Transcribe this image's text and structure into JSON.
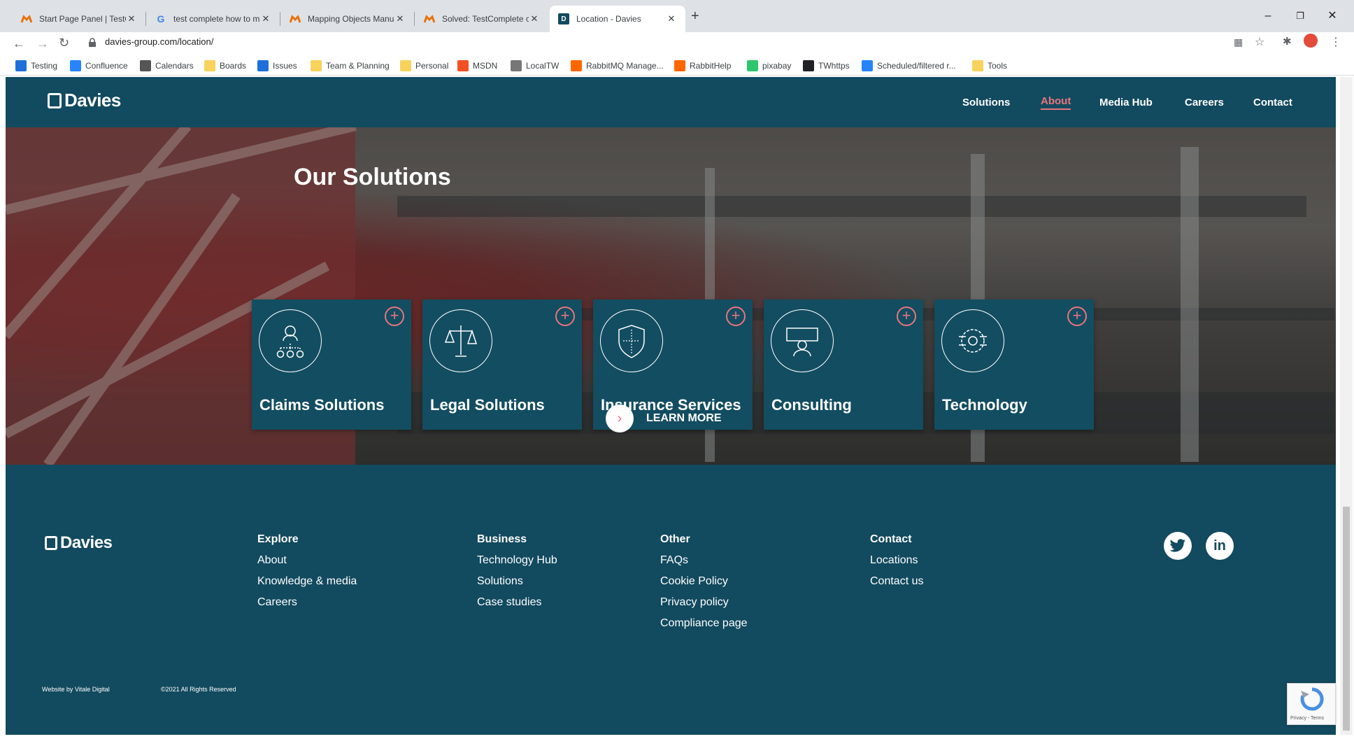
{
  "browser": {
    "tabs": [
      {
        "title": "Start Page Panel | TestComplete",
        "icon": "smartbear-icon",
        "color": "#e8710a"
      },
      {
        "title": "test complete how to map an ob",
        "icon": "google-icon",
        "color": "#4285f4"
      },
      {
        "title": "Mapping Objects Manually | Test",
        "icon": "smartbear-icon",
        "color": "#e8710a"
      },
      {
        "title": "Solved: TestComplete cannot finc",
        "icon": "smartbear-icon",
        "color": "#e8710a"
      },
      {
        "title": "Location - Davies",
        "icon": "davies-icon",
        "color": "#124a5f"
      }
    ],
    "new_tab": "+",
    "window_controls": {
      "minimize": "–",
      "restore": "❐",
      "close": "✕"
    },
    "url": "davies-group.com/location/",
    "bookmarks": [
      {
        "label": "Testing",
        "color": "#1e6fd9"
      },
      {
        "label": "Confluence",
        "color": "#2684ff"
      },
      {
        "label": "Calendars",
        "color": "#555555"
      },
      {
        "label": "Boards",
        "color": "#f7d35c"
      },
      {
        "label": "Issues",
        "color": "#1e6fd9"
      },
      {
        "label": "Team & Planning",
        "color": "#f7d35c"
      },
      {
        "label": "Personal",
        "color": "#f7d35c"
      },
      {
        "label": "MSDN",
        "color": "#f25022"
      },
      {
        "label": "LocalTW",
        "color": "#777777"
      },
      {
        "label": "RabbitMQ Manage...",
        "color": "#ff6600"
      },
      {
        "label": "RabbitHelp",
        "color": "#ff6600"
      },
      {
        "label": "pixabay",
        "color": "#2ec66d"
      },
      {
        "label": "TWhttps",
        "color": "#202124"
      },
      {
        "label": "Scheduled/filtered r...",
        "color": "#2684ff"
      },
      {
        "label": "Tools",
        "color": "#f7d35c"
      }
    ]
  },
  "site": {
    "logo": "Davies",
    "nav": [
      "Solutions",
      "About",
      "Media Hub",
      "Careers",
      "Contact"
    ],
    "active_nav": "About",
    "hero": {
      "heading": "Our Solutions",
      "cards": [
        {
          "title": "Claims Solutions",
          "icon": "people-network-icon"
        },
        {
          "title": "Legal Solutions",
          "icon": "scales-icon"
        },
        {
          "title": "Insurance Services",
          "icon": "shield-icon"
        },
        {
          "title": "Consulting",
          "icon": "presenter-icon"
        },
        {
          "title": "Technology",
          "icon": "gear-circuit-icon"
        }
      ],
      "learn_more": "LEARN MORE"
    },
    "footer": {
      "logo": "Davies",
      "columns": [
        {
          "heading": "Explore",
          "links": [
            "About",
            "Knowledge & media",
            "Careers"
          ]
        },
        {
          "heading": "Business",
          "links": [
            "Technology Hub",
            "Solutions",
            "Case studies"
          ]
        },
        {
          "heading": "Other",
          "links": [
            "FAQs",
            "Cookie Policy",
            "Privacy policy",
            "Compliance page"
          ]
        },
        {
          "heading": "Contact",
          "links": [
            "Locations",
            "Contact us"
          ]
        }
      ],
      "credit": "Website by Vitale Digital",
      "copyright": "©2021  All Rights Reserved",
      "recaptcha": "Privacy - Terms"
    },
    "colors": {
      "brand": "#124a5f",
      "accent": "#e8757c"
    }
  }
}
